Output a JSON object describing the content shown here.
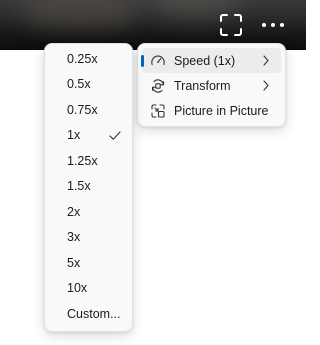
{
  "controls": {
    "fullscreen_icon": "fullscreen-icon",
    "more_icon": "more-horizontal-icon"
  },
  "main_menu": {
    "items": [
      {
        "label": "Speed (1x)",
        "icon": "speedometer-icon",
        "has_submenu": true,
        "highlighted": true
      },
      {
        "label": "Transform",
        "icon": "rotate-icon",
        "has_submenu": true,
        "highlighted": false
      },
      {
        "label": "Picture in Picture",
        "icon": "picture-in-picture-icon",
        "has_submenu": false,
        "highlighted": false
      }
    ]
  },
  "speed_menu": {
    "options": [
      "0.25x",
      "0.5x",
      "0.75x",
      "1x",
      "1.25x",
      "1.5x",
      "2x",
      "3x",
      "5x",
      "10x",
      "Custom..."
    ],
    "selected": "1x"
  },
  "colors": {
    "accent": "#0067c0",
    "menu_background": "#f9f9f9",
    "hover_background": "#ececec"
  }
}
